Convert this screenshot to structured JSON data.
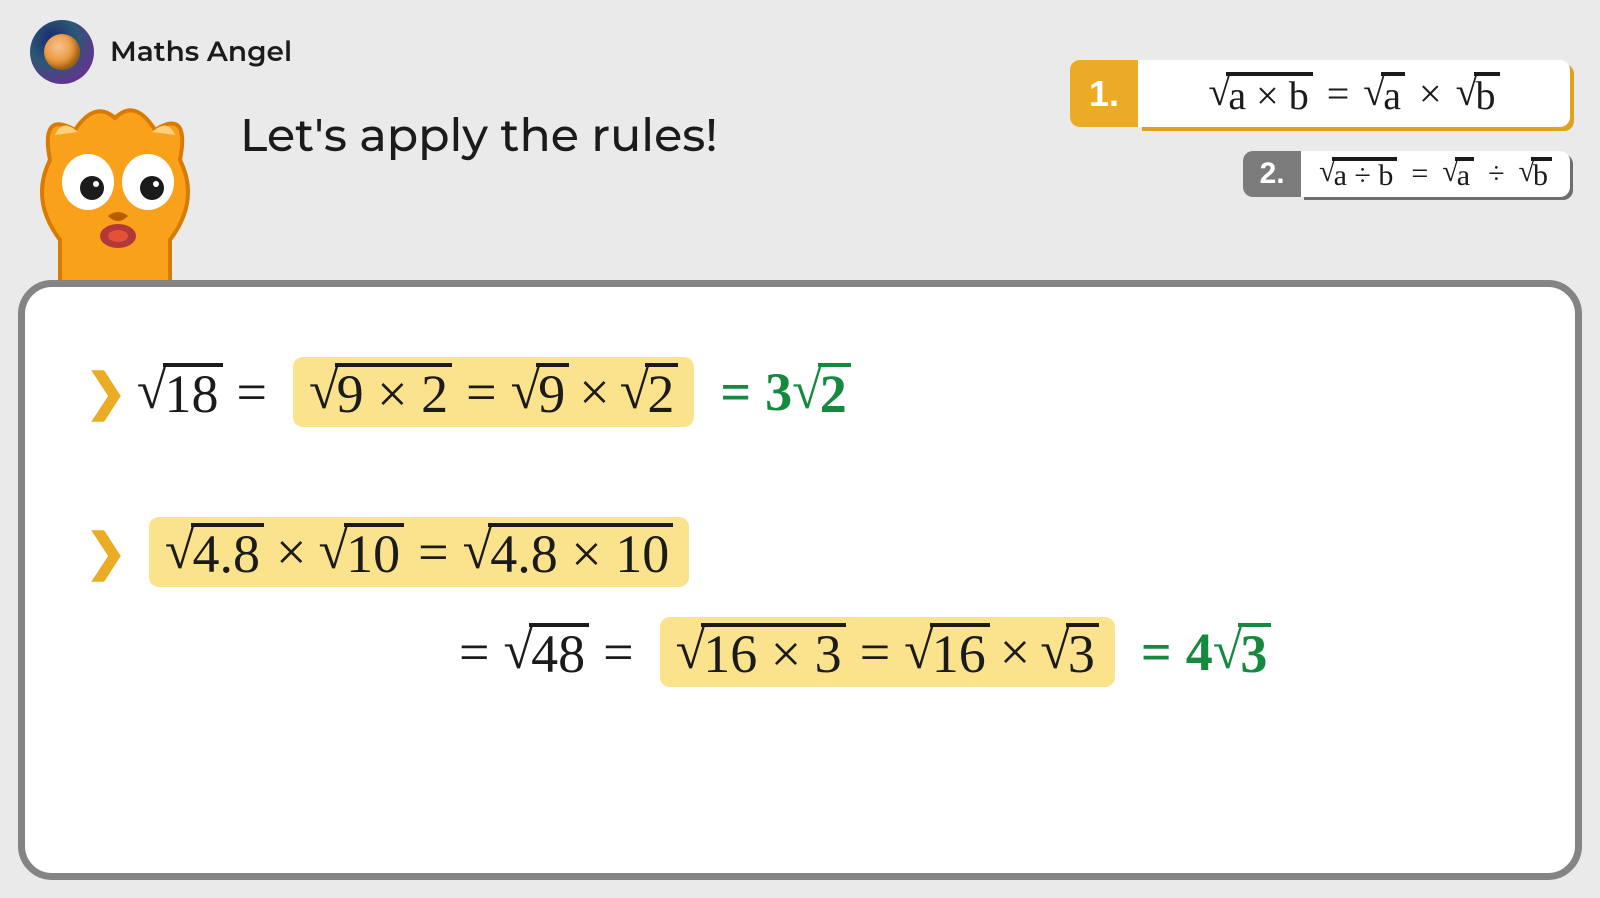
{
  "brand": "Maths Angel",
  "title": "Let's apply the rules!",
  "rules": {
    "r1": {
      "num": "1.",
      "lhs_body": "a × b",
      "rhs_a": "a",
      "rhs_b": "b",
      "op": "×"
    },
    "r2": {
      "num": "2.",
      "lhs_body": "a ÷ b",
      "rhs_a": "a",
      "rhs_b": "b",
      "op": "÷"
    }
  },
  "ex1": {
    "start": "18",
    "factored": "9 × 2",
    "split_a": "9",
    "split_b": "2",
    "result_coef": "3",
    "result_rad": "2"
  },
  "ex2": {
    "a": "4.8",
    "b": "10",
    "prod_body": "4.8 × 10",
    "prod_val": "48",
    "factored": "16 × 3",
    "split_a": "16",
    "split_b": "3",
    "result_coef": "4",
    "result_rad": "3"
  },
  "sym": {
    "eq": "=",
    "times": "×",
    "chev": "❯"
  }
}
